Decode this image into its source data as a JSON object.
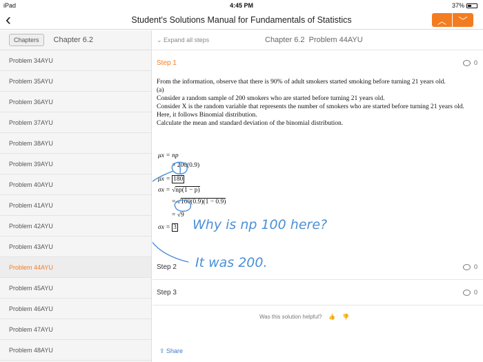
{
  "status": {
    "device": "iPad",
    "time": "4:45 PM",
    "battery": "37%"
  },
  "nav": {
    "back": "‹",
    "title": "Student's Solutions Manual for Fundamentals of Statistics",
    "prev": "︿",
    "next": "﹀"
  },
  "sidebar": {
    "chapters_button": "Chapters",
    "chapter": "Chapter 6.2",
    "problems": [
      "Problem 34AYU",
      "Problem 35AYU",
      "Problem 36AYU",
      "Problem 37AYU",
      "Problem 38AYU",
      "Problem 39AYU",
      "Problem 40AYU",
      "Problem 41AYU",
      "Problem 42AYU",
      "Problem 43AYU",
      "Problem 44AYU",
      "Problem 45AYU",
      "Problem 46AYU",
      "Problem 47AYU",
      "Problem 48AYU"
    ],
    "active": "Problem 44AYU"
  },
  "main": {
    "expand_label": "Expand all steps",
    "chapter_label": "Chapter 6.2",
    "problem_label": "Problem 44AYU",
    "step1": {
      "label": "Step 1",
      "comments": "0",
      "lines": [
        "From the information, observe that there is 90% of adult smokers started smoking before turning 21 years old.",
        "(a)",
        "Consider a random sample of 200 smokers who are started before turning 21 years old.",
        "Consider X is the random variable that represents the number of smokers who are started before turning 21 years old.",
        "Here, it follows Binomial distribution.",
        "Calculate the mean and standard deviation of the binomial distribution."
      ],
      "math": {
        "l1": "μ",
        "l1b": "x = np",
        "l2": "= 200(0.9)",
        "l3a": "μ",
        "l3b": "x =",
        "l3c": "180",
        "l4a": "σ",
        "l4b": "x = √",
        "l4c": "np(1 − p)",
        "l5a": "= √",
        "l5b": "100(0.9)(1 − 0.9)",
        "l6": "= √9",
        "l7a": "σ",
        "l7b": "x =",
        "l7c": "3"
      },
      "handwriting": [
        "Why is np 100 here?",
        "It was 200."
      ]
    },
    "step2": {
      "label": "Step 2",
      "comments": "0"
    },
    "step3": {
      "label": "Step 3",
      "comments": "0"
    },
    "helpful": "Was this solution helpful?",
    "thumbs_up": "👍",
    "thumbs_down": "👎",
    "share": "Share"
  }
}
